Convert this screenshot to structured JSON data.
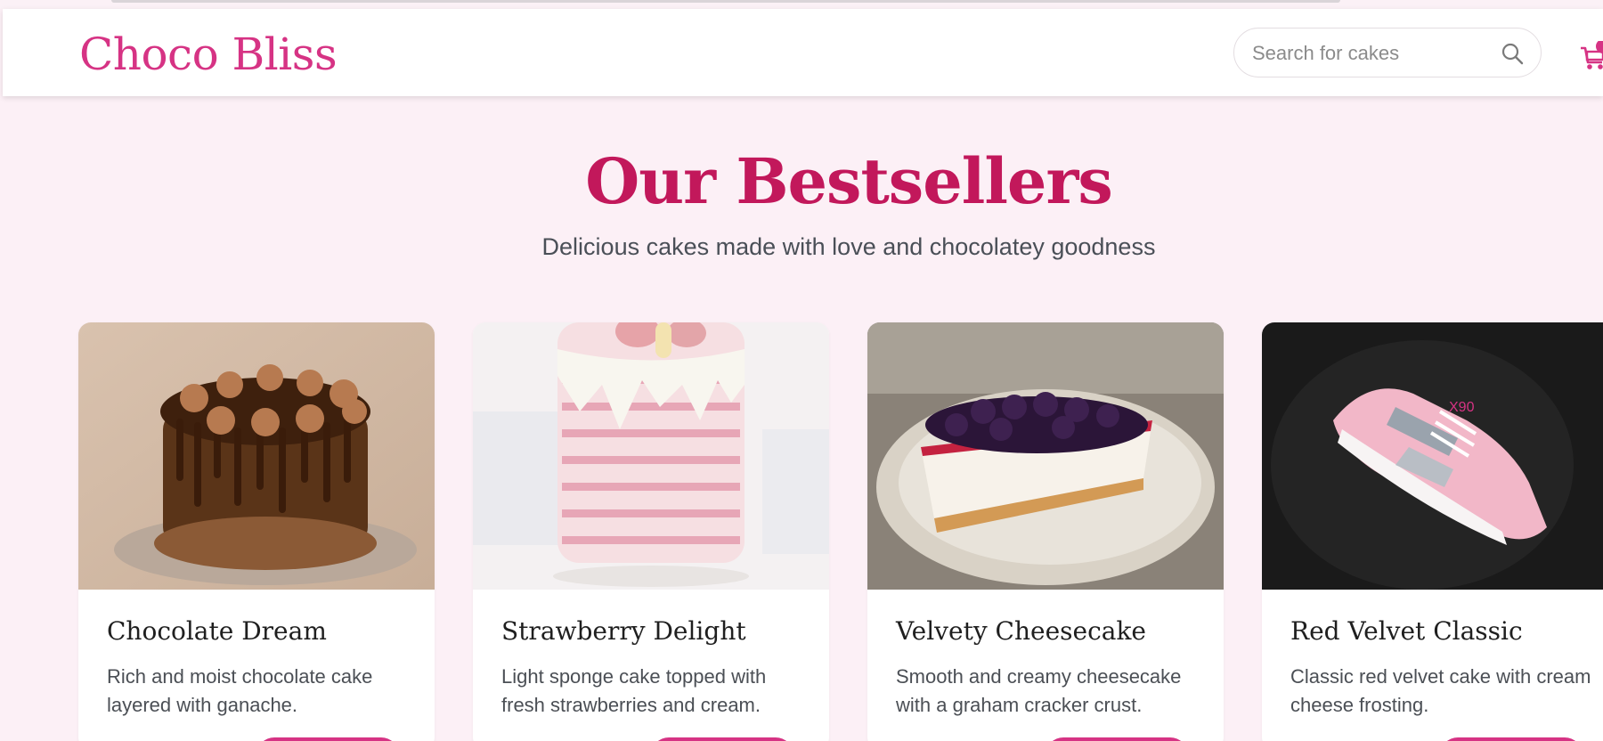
{
  "header": {
    "brand": "Choco Bliss",
    "search_placeholder": "Search for cakes",
    "search_icon": "search-icon",
    "cart_icon": "shopping-cart-icon"
  },
  "hero": {
    "title": "Our Bestsellers",
    "subtitle": "Delicious cakes made with love and chocolatey goodness"
  },
  "products": [
    {
      "name": "Chocolate Dream",
      "description": "Rich and moist chocolate cake layered with ganache."
    },
    {
      "name": "Strawberry Delight",
      "description": "Light sponge cake topped with fresh strawberries and cream."
    },
    {
      "name": "Velvety Cheesecake",
      "description": "Smooth and creamy cheesecake with a graham cracker crust."
    },
    {
      "name": "Red Velvet Classic",
      "description": "Classic red velvet cake with cream cheese frosting."
    }
  ],
  "colors": {
    "accent": "#d63384",
    "title": "#c2185b",
    "background": "#fcf0f6"
  }
}
